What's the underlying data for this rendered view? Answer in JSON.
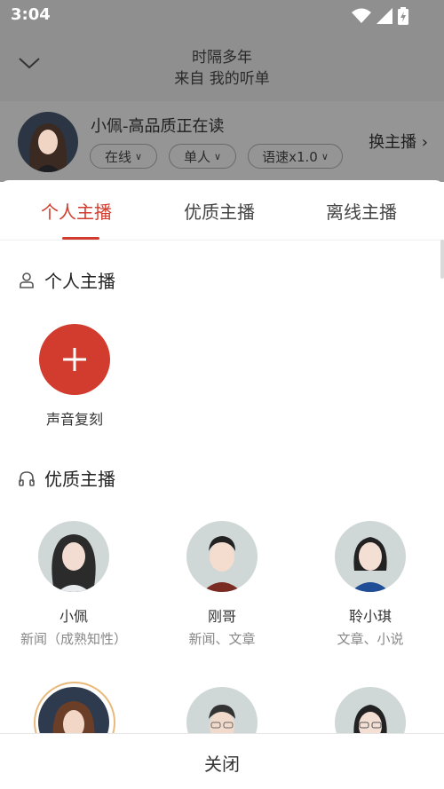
{
  "status_bar": {
    "time": "3:04"
  },
  "header": {
    "title_line1": "时隔多年",
    "title_line2": "来自 我的听单"
  },
  "current_anchor": {
    "name": "小佩-高品质正在读",
    "status": "在线",
    "mode": "单人",
    "speed": "语速x1.0",
    "switch_label": "换主播"
  },
  "tabs": [
    {
      "label": "个人主播",
      "active": true
    },
    {
      "label": "优质主播",
      "active": false
    },
    {
      "label": "离线主播",
      "active": false
    }
  ],
  "personal_section": {
    "title": "个人主播",
    "add_label": "声音复刻"
  },
  "quality_section": {
    "title": "优质主播",
    "hosts": [
      {
        "name": "小佩",
        "tags": "新闻（成熟知性）"
      },
      {
        "name": "刚哥",
        "tags": "新闻、文章"
      },
      {
        "name": "聆小琪",
        "tags": "文章、小说"
      }
    ]
  },
  "close_label": "关闭",
  "colors": {
    "accent": "#d23c2e",
    "selected_ring": "#e8b97a"
  }
}
